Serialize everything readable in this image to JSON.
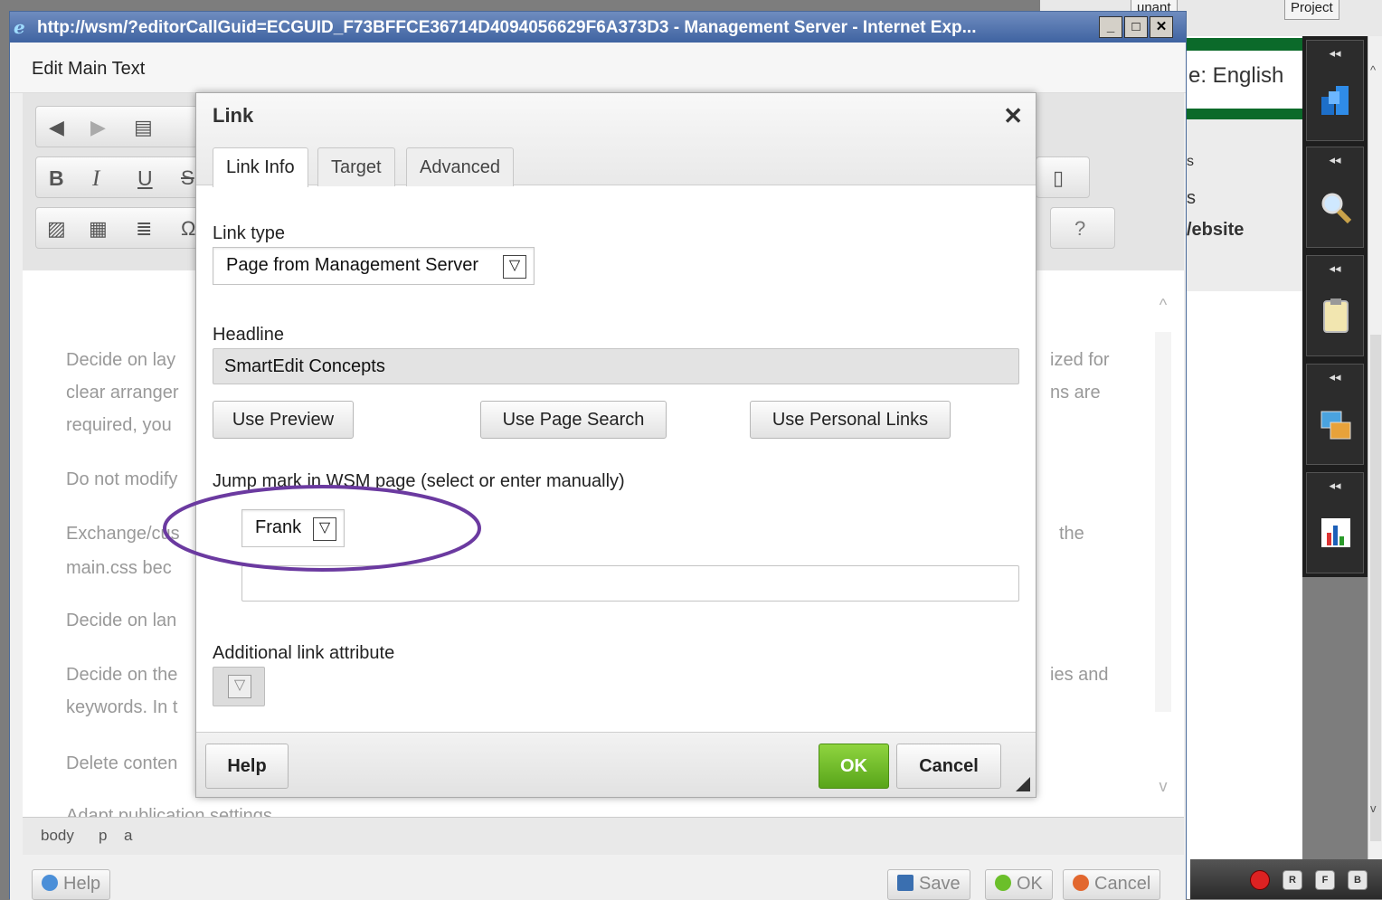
{
  "background_app": {
    "top_tab_fragments": [
      "unant",
      "Project"
    ],
    "language_label": "e: English",
    "text_fragments": [
      "s",
      "s"
    ],
    "website_fragment": "/ebsite",
    "side_panel": [
      {
        "collapse": "◂◂",
        "icon": "cube-icon"
      },
      {
        "collapse": "◂◂",
        "icon": "magnifier-icon"
      },
      {
        "collapse": "◂◂",
        "icon": "clipboard-icon"
      },
      {
        "collapse": "◂◂",
        "icon": "images-icon"
      },
      {
        "collapse": "◂◂",
        "icon": "chart-icon"
      }
    ],
    "bottom_buttons": [
      "R",
      "F",
      "B"
    ]
  },
  "window": {
    "title": "http://wsm/?editorCallGuid=ECGUID_F73BFFCE36714D4094056629F6A373D3 - Management Server - Internet Exp...",
    "controls": {
      "minimize": "_",
      "maximize": "□",
      "close": "✕"
    }
  },
  "editor": {
    "title": "Edit Main Text",
    "toolbar_row1": [
      "◀",
      "▶",
      "▤"
    ],
    "toolbar_row2": [
      "B",
      "I",
      "U",
      "S"
    ],
    "toolbar_row3": [
      "▨",
      "▦",
      "≣",
      "Ω"
    ],
    "toolbar_right": [
      "▯",
      "?"
    ],
    "content_lines": [
      "Decide on lay",
      "clear arranger",
      "required, you",
      "Do not modify",
      "Exchange/cus",
      "main.css bec",
      "Decide on lan",
      "Decide on the",
      "keywords. In t",
      "Delete conten",
      "Adapt publication settings"
    ],
    "content_right_fragments": [
      "ized for",
      "ns are",
      "the",
      "ies and"
    ],
    "path": [
      "body",
      "p",
      "a"
    ],
    "footer": {
      "help": "Help",
      "save": "Save",
      "ok": "OK",
      "cancel": "Cancel"
    }
  },
  "dialog": {
    "title": "Link",
    "close": "✕",
    "tabs": [
      "Link Info",
      "Target",
      "Advanced"
    ],
    "active_tab": "Link Info",
    "link_type": {
      "label": "Link type",
      "value": "Page from Management Server"
    },
    "headline": {
      "label": "Headline",
      "value": "SmartEdit Concepts"
    },
    "buttons": {
      "use_preview": "Use Preview",
      "use_page_search": "Use Page Search",
      "use_personal_links": "Use Personal Links"
    },
    "jump_mark": {
      "label": "Jump mark in WSM page (select or enter manually)",
      "value": "Frank",
      "manual_value": ""
    },
    "additional": {
      "label": "Additional link attribute"
    },
    "footer": {
      "help": "Help",
      "ok": "OK",
      "cancel": "Cancel"
    }
  },
  "colors": {
    "ok_button": "#6bbf2a",
    "annotation_ellipse": "#6b3aa0",
    "brand_green": "#0b6a2a"
  }
}
